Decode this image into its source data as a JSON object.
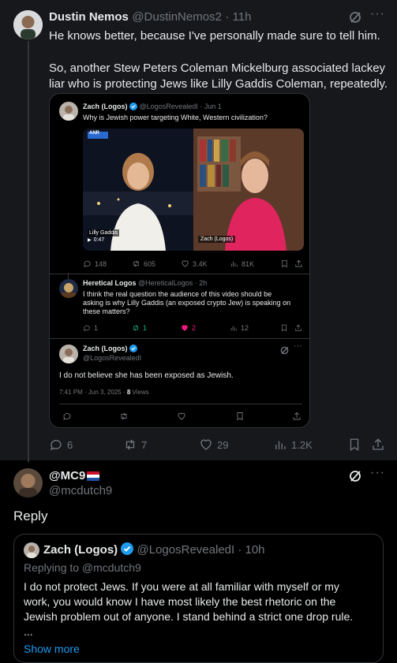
{
  "top_post": {
    "name": "Dustin Nemos",
    "handle": "@DustinNemos2",
    "time": "· 11h",
    "line1": "He knows better, because I've personally made sure to tell him.",
    "line2": "So, another Stew Peters Coleman Mickelburg associated lackey",
    "line3": "liar who is protecting Jews like Lilly Gaddis Coleman, repeatedly.",
    "actions": {
      "replies": "6",
      "reposts": "7",
      "likes": "29",
      "views": "1.2K"
    }
  },
  "quoted_thread": {
    "post1": {
      "name": "Zach (Logos)",
      "handle": "@LogosRevealedI",
      "time": "· Jun 1",
      "text": "Why is Jewish power targeting White, Western civilization?",
      "video": {
        "left_label": "Lilly Gaddis",
        "time": "0:47",
        "right_label": "Zach (Logos)",
        "brand": "ANR"
      },
      "actions": {
        "replies": "148",
        "reposts": "605",
        "likes": "3.4K",
        "views": "81K"
      }
    },
    "post2": {
      "name": "Heretical Logos",
      "handle": "@HereticalLogos",
      "time": "· 2h",
      "line1": "I think the real question the audience of this video should be",
      "line2": "asking is why Lilly Gaddis (an exposed crypto Jew) is speaking on",
      "line3": "these matters?",
      "actions": {
        "replies": "1",
        "reposts": "1",
        "likes": "2",
        "views": "12"
      }
    },
    "post3": {
      "name": "Zach (Logos)",
      "handle": "@LogosRevealedI",
      "text": "I do not believe she has been exposed as Jewish.",
      "timestamp": "7:41 PM · Jun 3, 2025 ·",
      "views_count": "8",
      "views_label": "Views"
    }
  },
  "reply_post": {
    "name": "@MC9",
    "handle": "@mcdutch9",
    "text": "Reply",
    "quote": {
      "name": "Zach (Logos)",
      "handle": "@LogosRevealedI",
      "time": "· 10h",
      "replying_to": "Replying to @mcdutch9",
      "line1": "I do not protect Jews. If you were at all familiar with myself or my",
      "line2": "work, you would know I have most likely the best rhetoric on the",
      "line3": "Jewish problem out of anyone. I stand behind a strict one drop rule.",
      "line4": "...",
      "show_more": "Show more"
    }
  },
  "colors": {
    "accent": "#1d9bf0",
    "like_pink": "#f91880",
    "repost_green": "#00ba7c",
    "muted": "#71767b",
    "background": "#000000",
    "top_post_bg": "#16181c"
  }
}
